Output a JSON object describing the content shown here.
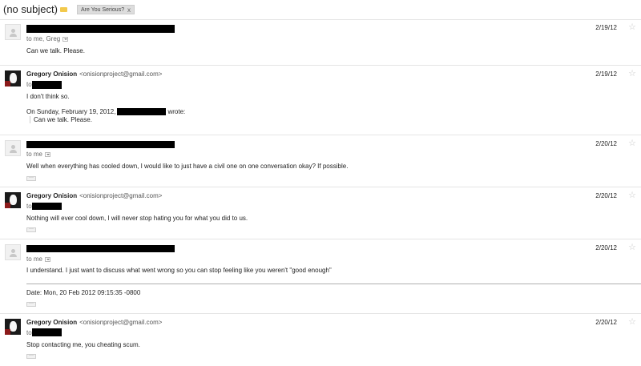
{
  "subject": "(no subject)",
  "label": {
    "name": "Are You Serious?",
    "remove": "x"
  },
  "messages": [
    {
      "recipients": "to me, Greg",
      "date": "2/19/12",
      "body": "Can we talk. Please."
    },
    {
      "sender_name": "Gregory Onision",
      "sender_email": "<onisionproject@gmail.com>",
      "recipients_prefix": "to",
      "date": "2/19/12",
      "body": "I don't think so.",
      "quote_header_before": "On Sunday, February 19, 2012,",
      "quote_header_after": "wrote:",
      "quote": "Can we talk. Please."
    },
    {
      "recipients": "to me",
      "date": "2/20/12",
      "body": "Well when everything has cooled down, I would like to just have a civil one on one conversation okay? If possible."
    },
    {
      "sender_name": "Gregory Onision",
      "sender_email": "<onisionproject@gmail.com>",
      "recipients_prefix": "to",
      "date": "2/20/12",
      "body": "Nothing will ever cool down, I will never stop hating you for what you did to us."
    },
    {
      "recipients": "to me",
      "date": "2/20/12",
      "body": "I understand. I just want to discuss what went wrong so you can stop feeling like you weren't \"good enough\"",
      "date_line": "Date: Mon, 20 Feb 2012 09:15:35 -0800"
    },
    {
      "sender_name": "Gregory Onision",
      "sender_email": "<onisionproject@gmail.com>",
      "recipients_prefix": "to",
      "date": "2/20/12",
      "body": "Stop contacting me, you cheating scum."
    }
  ],
  "icons": {
    "star": "star-icon",
    "label": "label-icon",
    "avatar": "avatar-icon"
  }
}
